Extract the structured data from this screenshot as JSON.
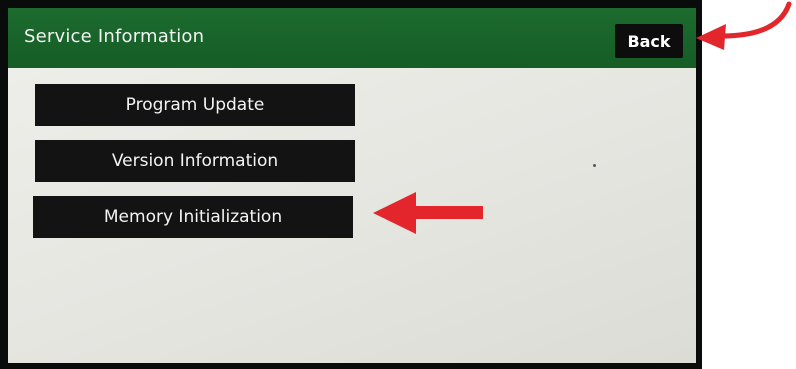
{
  "header": {
    "title": "Service Information",
    "back_label": "Back",
    "bg_color": "#1a6a2e"
  },
  "menu": {
    "items": [
      {
        "label": "Program Update"
      },
      {
        "label": "Version Information"
      },
      {
        "label": "Memory Initialization"
      }
    ]
  },
  "annotations": {
    "arrow_color": "#e3262b",
    "arrows": [
      {
        "points_to": "Back"
      },
      {
        "points_to": "Memory Initialization"
      }
    ]
  }
}
